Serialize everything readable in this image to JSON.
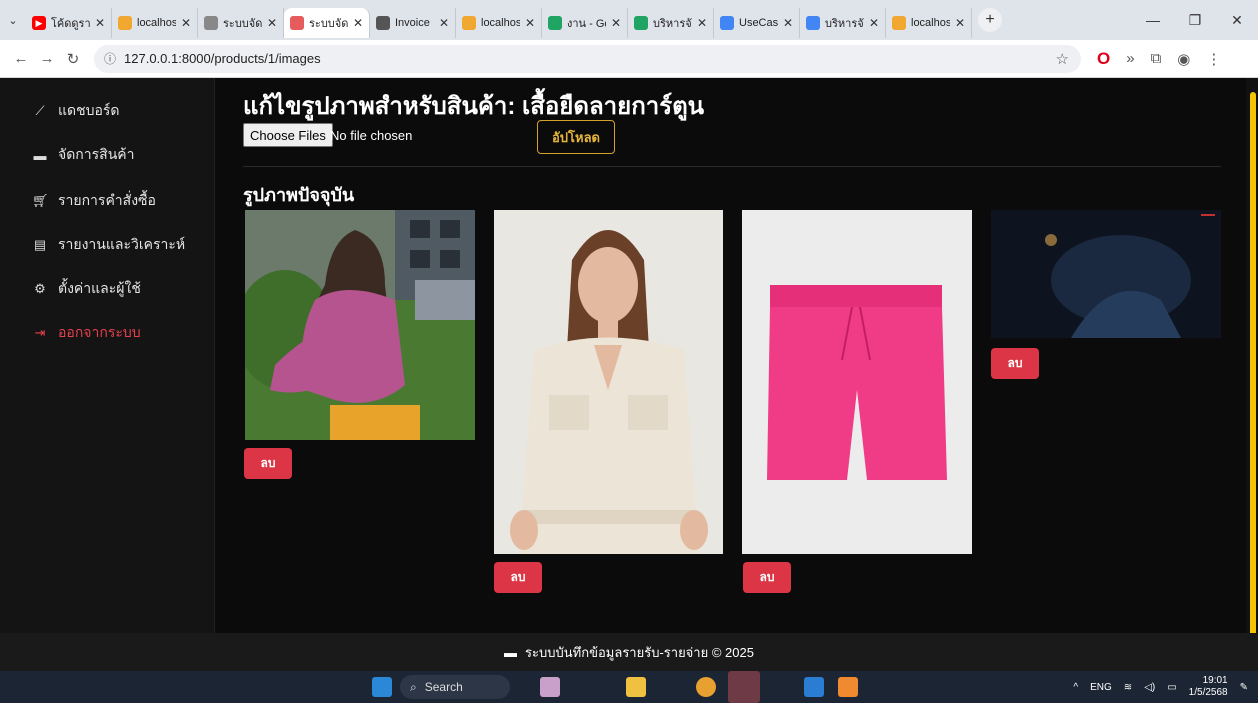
{
  "browser": {
    "tabs": [
      {
        "title": "โค้ดดูรายได้",
        "fav_color": "#ff0000",
        "active": false
      },
      {
        "title": "localhost",
        "fav_color": "#f0a830",
        "active": false
      },
      {
        "title": "ระบบจัดการ",
        "fav_color": "#888888",
        "active": false
      },
      {
        "title": "ระบบจัดการ",
        "fav_color": "#e65b5b",
        "active": true
      },
      {
        "title": "Invoice",
        "fav_color": "#555555",
        "active": false
      },
      {
        "title": "localhost",
        "fav_color": "#f0a830",
        "active": false
      },
      {
        "title": "งาน - Go",
        "fav_color": "#1fa463",
        "active": false
      },
      {
        "title": "บริหารจัดการ",
        "fav_color": "#1fa463",
        "active": false
      },
      {
        "title": "UseCase",
        "fav_color": "#4285f4",
        "active": false
      },
      {
        "title": "บริหารจัดการ",
        "fav_color": "#4285f4",
        "active": false
      },
      {
        "title": "localhost",
        "fav_color": "#f0a830",
        "active": false
      }
    ],
    "url": "127.0.0.1:8000/products/1/images"
  },
  "sidebar": {
    "items": [
      {
        "label": "แดชบอร์ด",
        "icon": "chart-line-icon"
      },
      {
        "label": "จัดการสินค้า",
        "icon": "box-icon"
      },
      {
        "label": "รายการคำสั่งซื้อ",
        "icon": "cart-icon"
      },
      {
        "label": "รายงานและวิเคราะห์",
        "icon": "bar-chart-icon"
      },
      {
        "label": "ตั้งค่าและผู้ใช้",
        "icon": "gears-icon"
      },
      {
        "label": "ออกจากระบบ",
        "icon": "logout-icon"
      }
    ]
  },
  "main": {
    "title": "แก้ไขรูปภาพสำหรับสินค้า: เสื้อยืดลายการ์ตูน",
    "file_button": "Choose Files",
    "file_status": "No file chosen",
    "upload_label": "อัปโหลด",
    "section_title": "รูปภาพปัจจุบัน",
    "delete_label": "ลบ",
    "images": [
      {
        "alt": "woman in pink knit top on street",
        "accent": "#b5548f"
      },
      {
        "alt": "woman in cream utility jumpsuit",
        "accent": "#e9e1d2"
      },
      {
        "alt": "pink shorts",
        "accent": "#f03c86"
      },
      {
        "alt": "dark night scene",
        "accent": "#1a2940"
      }
    ]
  },
  "footer": {
    "text": "ระบบบันทึกข้อมูลรายรับ-รายจ่าย © 2025"
  },
  "taskbar": {
    "search": "Search",
    "lang": "ENG",
    "time": "19:01",
    "date": "1/5/2568"
  },
  "colors": {
    "accent": "#f4c400",
    "danger": "#dc3545",
    "upload": "#d4a12a"
  }
}
